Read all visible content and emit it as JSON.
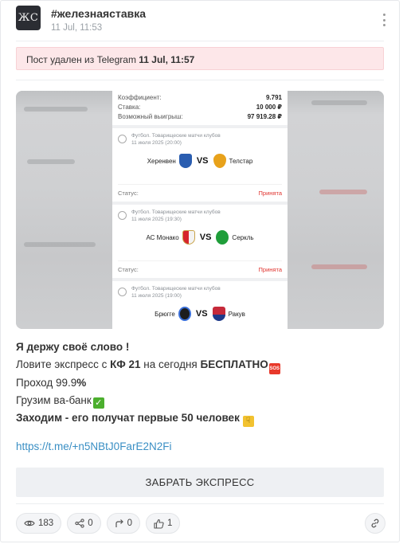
{
  "channel": {
    "avatar_text": "ЖС",
    "title": "#железнаяставка",
    "date": "11 Jul, 11:53"
  },
  "deleted_notice": {
    "text": "Пост удален из Telegram ",
    "date": "11 Jul, 11:57"
  },
  "ticket": {
    "summary": [
      {
        "label": "Коэффициент:",
        "value": "9.791"
      },
      {
        "label": "Ставка:",
        "value": "10 000 ₽"
      },
      {
        "label": "Возможный выигрыш:",
        "value": "97 919.28 ₽"
      }
    ],
    "vs_label": "VS",
    "status_label": "Статус:",
    "matches": [
      {
        "league": "Футбол. Товарищеские матчи клубов",
        "date": "11 июля 2025 (20:00)",
        "home": "Херенвен",
        "away": "Телстар",
        "status": "Принята",
        "home_color": "#2a5db0",
        "away_color": "#e8a21b"
      },
      {
        "league": "Футбол. Товарищеские матчи клубов",
        "date": "11 июля 2025 (19:30)",
        "home": "АС Монако",
        "away": "Серкль",
        "status": "Принята",
        "home_color": "#d6262c",
        "away_color": "#1f9e3a"
      },
      {
        "league": "Футбол. Товарищеские матчи клубов",
        "date": "11 июля 2025 (19:00)",
        "home": "Брюгге",
        "away": "Ракув",
        "status": "",
        "home_color": "#1d1d1d",
        "away_color": "#c62a3a"
      }
    ]
  },
  "post": {
    "line1": "Я держу своё слово !",
    "line2_pre": "Ловите экспресс с ",
    "line2_kf": "КФ 21",
    "line2_mid": " на сегодня ",
    "line2_free": "БЕСПЛАТНО",
    "line3_pre": "Проход 99.9",
    "line3_pct": "%",
    "line4": "Грузим ва-банк",
    "line5": "Заходим - его получат первые 50  человек",
    "link": "https://t.me/+n5NBtJ0FarE2N2Fi"
  },
  "cta_label": "ЗАБРАТЬ ЭКСПРЕСС",
  "stats": {
    "views": "183",
    "shares": "0",
    "forwards": "0",
    "likes": "1"
  },
  "colors": {
    "deleted_bg": "#fde7e9",
    "link": "#3a8fc4",
    "status_accepted": "#e0342f"
  }
}
